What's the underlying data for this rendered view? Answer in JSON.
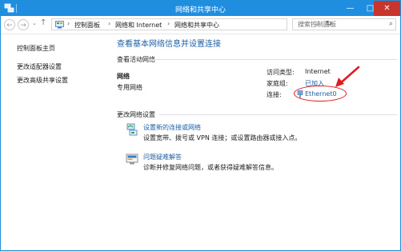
{
  "window": {
    "title": "网络和共享中心",
    "minimize_glyph": "—",
    "maximize_glyph": "□",
    "close_glyph": "✕"
  },
  "address": {
    "breadcrumbs": [
      "控制面板",
      "网络和 Internet",
      "网络和共享中心"
    ],
    "search_placeholder": "搜索控制面板",
    "back_glyph": "←",
    "forward_glyph": "→",
    "recent_glyph": "⌄",
    "up_glyph": "↑",
    "crumb_sep": "›",
    "dropdown_glyph": "⌄",
    "refresh_glyph": "↻",
    "search_glyph": "⌕"
  },
  "sidebar": {
    "items": [
      {
        "label": "控制面板主页"
      },
      {
        "label": "更改适配器设置"
      },
      {
        "label": "更改高级共享设置"
      }
    ]
  },
  "main": {
    "title": "查看基本网络信息并设置连接",
    "active_header": "查看活动网络",
    "network_name": "网络",
    "network_category": "专用网络",
    "details": {
      "access_type_label": "访问类型:",
      "access_type_value": "Internet",
      "homegroup_label": "家庭组:",
      "homegroup_value": "已加入",
      "connections_label": "连接:",
      "connections_value": "Ethernet0"
    },
    "change_header": "更改网络设置",
    "tasks": [
      {
        "title": "设置新的连接或网络",
        "desc": "设置宽带、拨号或 VPN 连接；或设置路由器或接入点。"
      },
      {
        "title": "问题疑难解答",
        "desc": "诊断并修复网络问题，或者获得疑难解答信息。"
      }
    ]
  },
  "colors": {
    "titlebar": "#1f8ee0",
    "link": "#1d5fa5",
    "annotation": "#e21b23",
    "close": "#c7352c"
  }
}
